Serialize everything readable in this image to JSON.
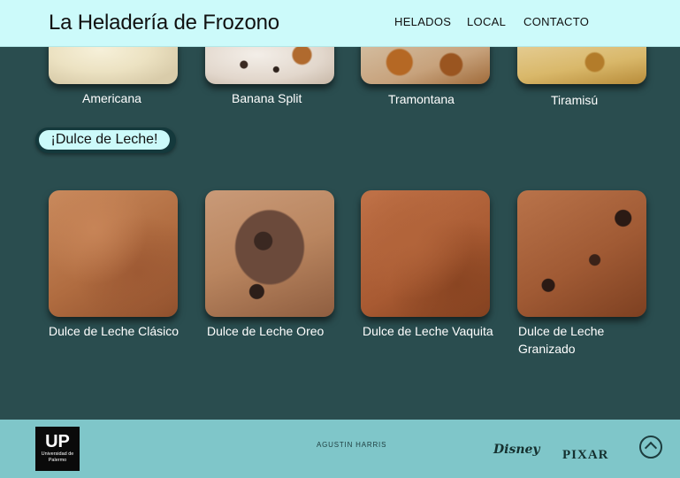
{
  "header": {
    "brand": "La Heladería de Frozono",
    "nav": [
      "HELADOS",
      "LOCAL",
      "CONTACTO"
    ]
  },
  "top_row": [
    {
      "label": "Americana"
    },
    {
      "label": "Banana Split"
    },
    {
      "label": "Tramontana"
    },
    {
      "label": "Tiramisú"
    }
  ],
  "section": {
    "title": "¡Dulce de Leche!"
  },
  "dulce_row": [
    {
      "label": "Dulce de Leche Clásico"
    },
    {
      "label": "Dulce de Leche Oreo"
    },
    {
      "label": "Dulce de Leche Vaquita"
    },
    {
      "label": "Dulce de Leche Granizado"
    }
  ],
  "footer": {
    "logo_text": "UP",
    "logo_sub": "Universidad de Palermo",
    "author": "AGUSTIN HARRIS",
    "brands": [
      "Disney",
      "PIXAR"
    ]
  },
  "colors": {
    "background": "#2a4d4f",
    "header": "#ccfafa",
    "footer": "#7fc6c9"
  }
}
